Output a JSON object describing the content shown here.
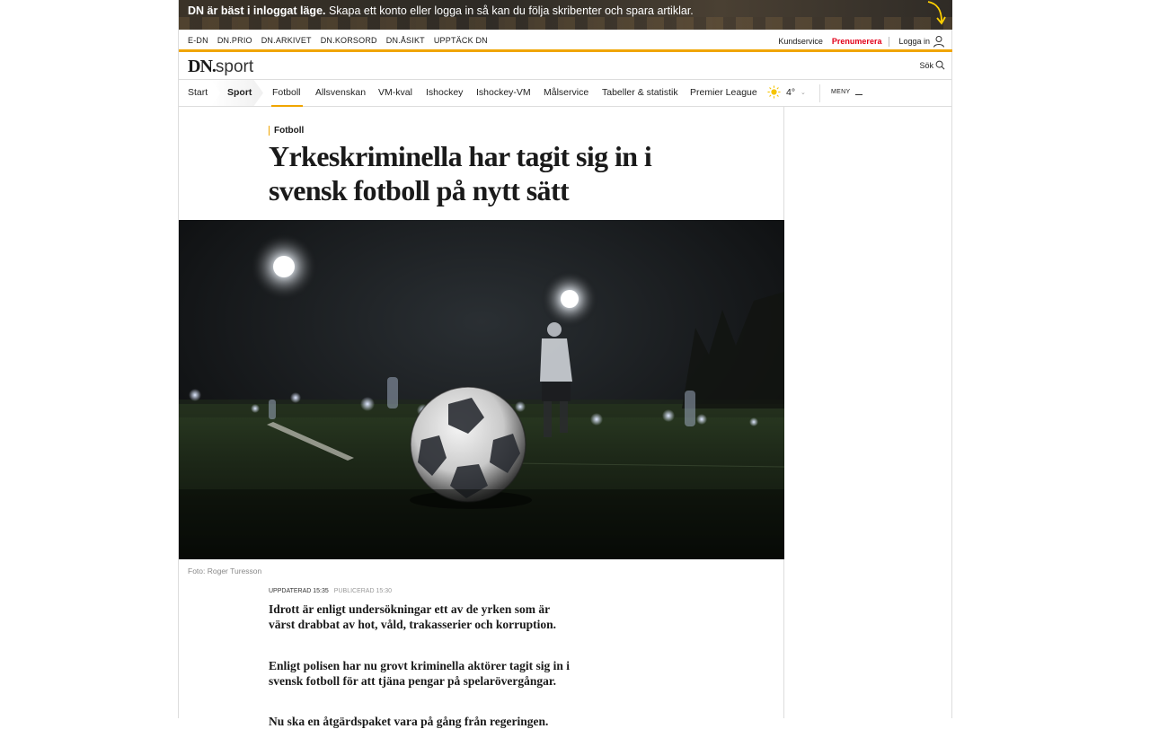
{
  "promo": {
    "bold": "DN är bäst i inloggat läge.",
    "text": " Skapa ett konto eller logga in så kan du följa skribenter och spara artiklar."
  },
  "toplinks": {
    "left": [
      "E-DN",
      "DN.PRIO",
      "DN.ARKIVET",
      "DN.KORSORD",
      "DN.ÅSIKT",
      "UPPTÄCK DN"
    ],
    "kundservice": "Kundservice",
    "prenumerera": "Prenumerera",
    "login": "Logga in"
  },
  "logo": {
    "brand": "DN.",
    "section": "sport"
  },
  "search_label": "Sök",
  "nav": {
    "items": [
      "Start",
      "Sport",
      "Fotboll",
      "Allsvenskan",
      "VM-kval",
      "Ishockey",
      "Ishockey-VM",
      "Målservice",
      "Tabeller & statistik",
      "Premier League"
    ],
    "temperature": "4°",
    "menu": "MENY"
  },
  "article": {
    "kicker": "Fotboll",
    "headline": "Yrkeskriminella har tagit sig in i svensk fotboll på nytt sätt",
    "caption": "Foto: Roger Turesson",
    "updated": "UPPDATERAD 15:35",
    "published": "PUBLICERAD 15:30",
    "paragraphs": [
      "Idrott är enligt undersökningar ett av de yrken som är värst drabbat av hot, våld, trakasserier och korruption.",
      "Enligt polisen har nu grovt kriminella aktörer tagit sig in i svensk fotboll för att tjäna pengar på spelarövergångar.",
      "Nu ska en åtgärdspaket vara på gång från regeringen."
    ]
  },
  "colors": {
    "accent": "#f0a500",
    "subscribe": "#e2001a"
  }
}
